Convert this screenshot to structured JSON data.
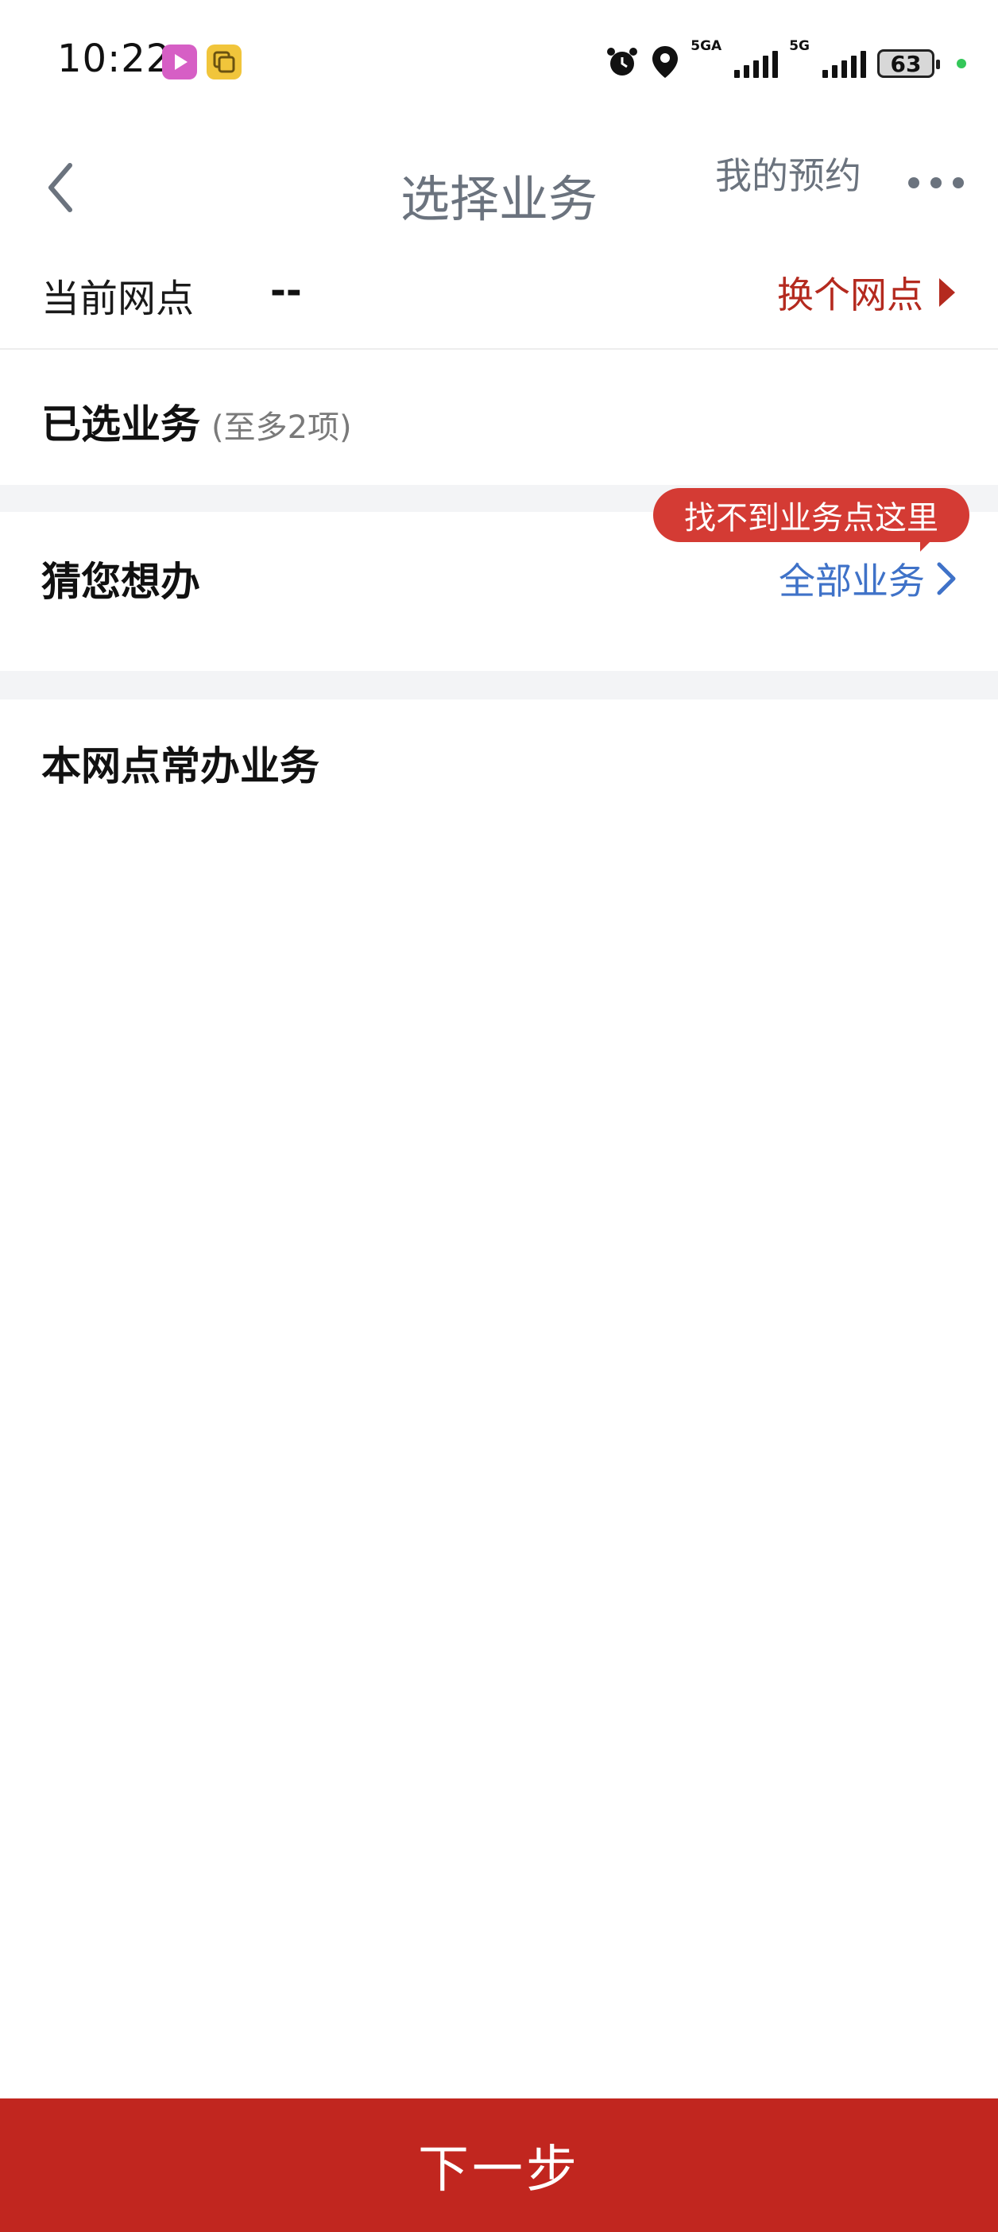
{
  "status_bar": {
    "time": "10:22",
    "network_1": "5GA",
    "network_2": "5G",
    "battery": "63",
    "icons": [
      "video-app-icon",
      "copy-app-icon",
      "alarm-icon",
      "location-icon",
      "signal-icon",
      "battery-icon"
    ]
  },
  "nav": {
    "title": "选择业务",
    "my_booking": "我的预约",
    "back_icon": "chevron-left-icon",
    "more_icon": "more-dots-icon"
  },
  "branch": {
    "label": "当前网点",
    "value": "--",
    "change_label": "换个网点"
  },
  "selected": {
    "title": "已选业务",
    "hint": "(至多2项)"
  },
  "guess": {
    "title": "猜您想办",
    "all_services": "全部业务",
    "tooltip": "找不到业务点这里"
  },
  "common": {
    "title": "本网点常办业务"
  },
  "footer": {
    "next_label": "下一步"
  },
  "colors": {
    "accent_red": "#c1261f",
    "link_blue": "#3f72c8",
    "tooltip_red": "#d43b34",
    "title_gray": "#6b737e"
  }
}
